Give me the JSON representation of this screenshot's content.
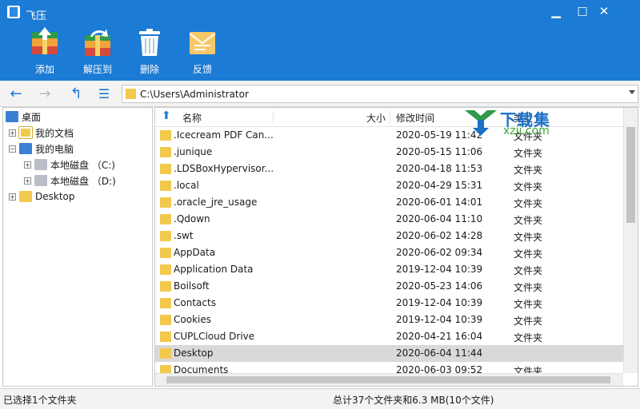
{
  "window": {
    "title": "飞压",
    "min": "▁",
    "max": "□",
    "close": "✕"
  },
  "toolbar": {
    "add_label": "添加",
    "extract_label": "解压到",
    "delete_label": "删除",
    "feedback_label": "反馈"
  },
  "nav": {
    "back": "←",
    "forward": "→",
    "up": "↰",
    "view": "☰",
    "path": "C:\\Users\\Administrator"
  },
  "tree": {
    "desktop_root": "桌面",
    "my_documents": "我的文档",
    "my_computer": "我的电脑",
    "drive_c": "本地磁盘 （C:)",
    "drive_d": "本地磁盘 （D:)",
    "desktop_folder": "Desktop"
  },
  "list": {
    "columns": {
      "name": "名称",
      "size": "大小",
      "modified": "修改时间",
      "type": "类型"
    },
    "rows": [
      {
        "name": ".Icecream PDF Can...",
        "modified": "2020-05-19 11:42",
        "type": "文件夹"
      },
      {
        "name": ".junique",
        "modified": "2020-05-15 11:06",
        "type": "文件夹"
      },
      {
        "name": ".LDSBoxHypervisor...",
        "modified": "2020-04-18 11:53",
        "type": "文件夹"
      },
      {
        "name": ".local",
        "modified": "2020-04-29 15:31",
        "type": "文件夹"
      },
      {
        "name": ".oracle_jre_usage",
        "modified": "2020-06-01 14:01",
        "type": "文件夹"
      },
      {
        "name": ".Qdown",
        "modified": "2020-06-04 11:10",
        "type": "文件夹"
      },
      {
        "name": ".swt",
        "modified": "2020-06-02 14:28",
        "type": "文件夹"
      },
      {
        "name": "AppData",
        "modified": "2020-06-02 09:34",
        "type": "文件夹"
      },
      {
        "name": "Application Data",
        "modified": "2019-12-04 10:39",
        "type": "文件夹"
      },
      {
        "name": "Boilsoft",
        "modified": "2020-05-23 14:06",
        "type": "文件夹"
      },
      {
        "name": "Contacts",
        "modified": "2019-12-04 10:39",
        "type": "文件夹"
      },
      {
        "name": "Cookies",
        "modified": "2019-12-04 10:39",
        "type": "文件夹"
      },
      {
        "name": "CUPLCloud Drive",
        "modified": "2020-04-21 16:04",
        "type": "文件夹"
      },
      {
        "name": "Desktop",
        "modified": "2020-06-04 11:44",
        "type": ""
      },
      {
        "name": "Documents",
        "modified": "2020-06-03 09:52",
        "type": "文件夹"
      }
    ]
  },
  "status": {
    "selection": "已选择1个文件夹",
    "summary": "总计37个文件夹和6.3 MB(10个文件)"
  },
  "watermark": {
    "line1": "下载集",
    "line2": "xzji.com"
  },
  "colors": {
    "titlebar": "#1c7bd4",
    "selected_row": "#d9d9d9",
    "folder": "#f2c94c"
  }
}
